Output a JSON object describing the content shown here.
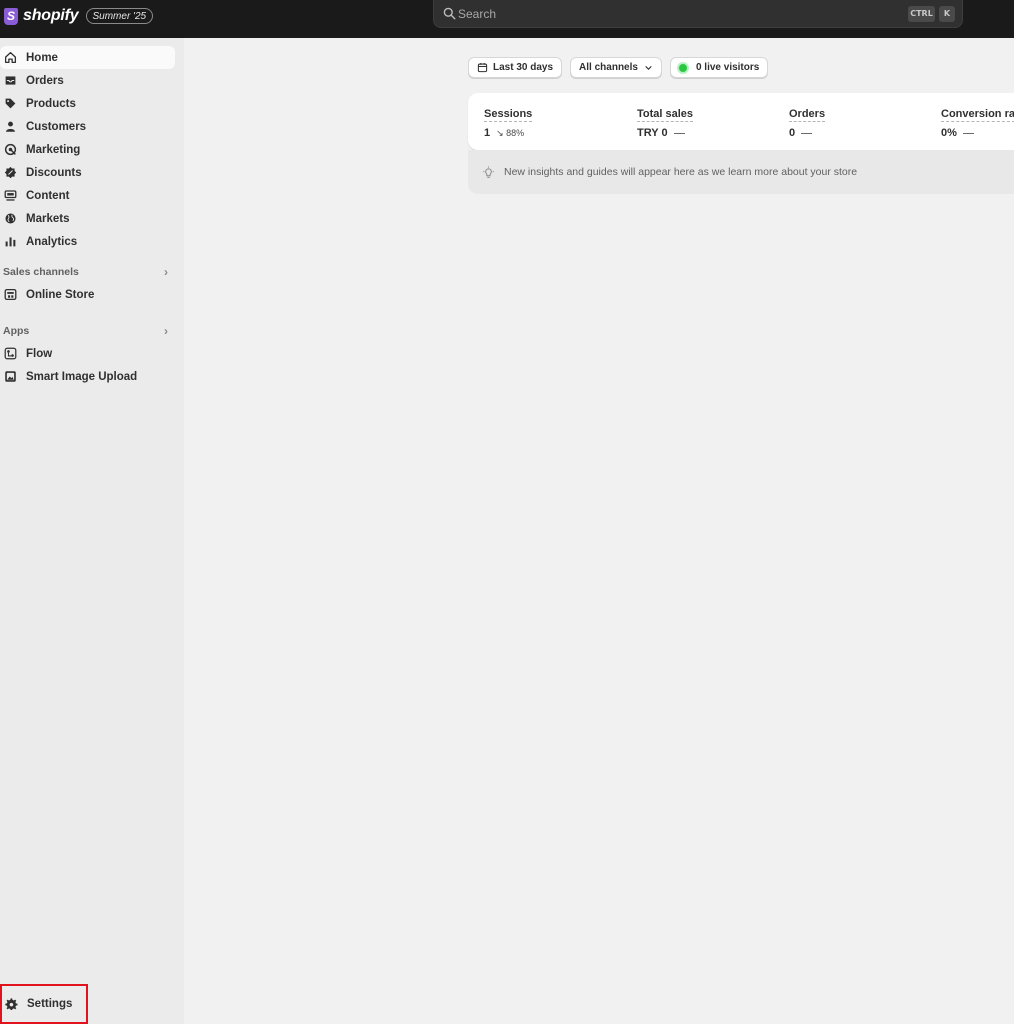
{
  "topbar": {
    "brand_logo": "S",
    "brand_name": "shopify",
    "edition": "Summer '25",
    "search_placeholder": "Search",
    "shortcut_ctrl": "CTRL",
    "shortcut_k": "K"
  },
  "sidebar": {
    "items": [
      {
        "label": "Home",
        "icon": "home-icon",
        "active": true
      },
      {
        "label": "Orders",
        "icon": "inbox-icon"
      },
      {
        "label": "Products",
        "icon": "tag-icon"
      },
      {
        "label": "Customers",
        "icon": "person-icon"
      },
      {
        "label": "Marketing",
        "icon": "target-icon"
      },
      {
        "label": "Discounts",
        "icon": "discount-icon"
      },
      {
        "label": "Content",
        "icon": "content-icon"
      },
      {
        "label": "Markets",
        "icon": "globe-icon"
      },
      {
        "label": "Analytics",
        "icon": "bar-chart-icon"
      }
    ],
    "sales_channels_header": "Sales channels",
    "sales_channels": [
      {
        "label": "Online Store",
        "icon": "store-icon"
      }
    ],
    "apps_header": "Apps",
    "apps": [
      {
        "label": "Flow",
        "icon": "flow-icon"
      },
      {
        "label": "Smart Image Upload",
        "icon": "image-upload-icon"
      }
    ],
    "settings_label": "Settings"
  },
  "main": {
    "date_range": "Last 30 days",
    "channel_filter": "All channels",
    "live_visitors": "0 live visitors",
    "metrics": [
      {
        "label": "Sessions",
        "value": "1",
        "delta": "↘ 88%"
      },
      {
        "label": "Total sales",
        "value": "TRY 0",
        "delta": "—"
      },
      {
        "label": "Orders",
        "value": "0",
        "delta": "—"
      },
      {
        "label": "Conversion ra",
        "value": "0%",
        "delta": "—"
      }
    ],
    "insights_text": "New insights and guides will appear here as we learn more about your store"
  },
  "colors": {
    "topbar": "#1a1a1a",
    "sidebar": "#ebebeb",
    "live_dot": "#29c840",
    "highlight_box": "#e0131f"
  }
}
